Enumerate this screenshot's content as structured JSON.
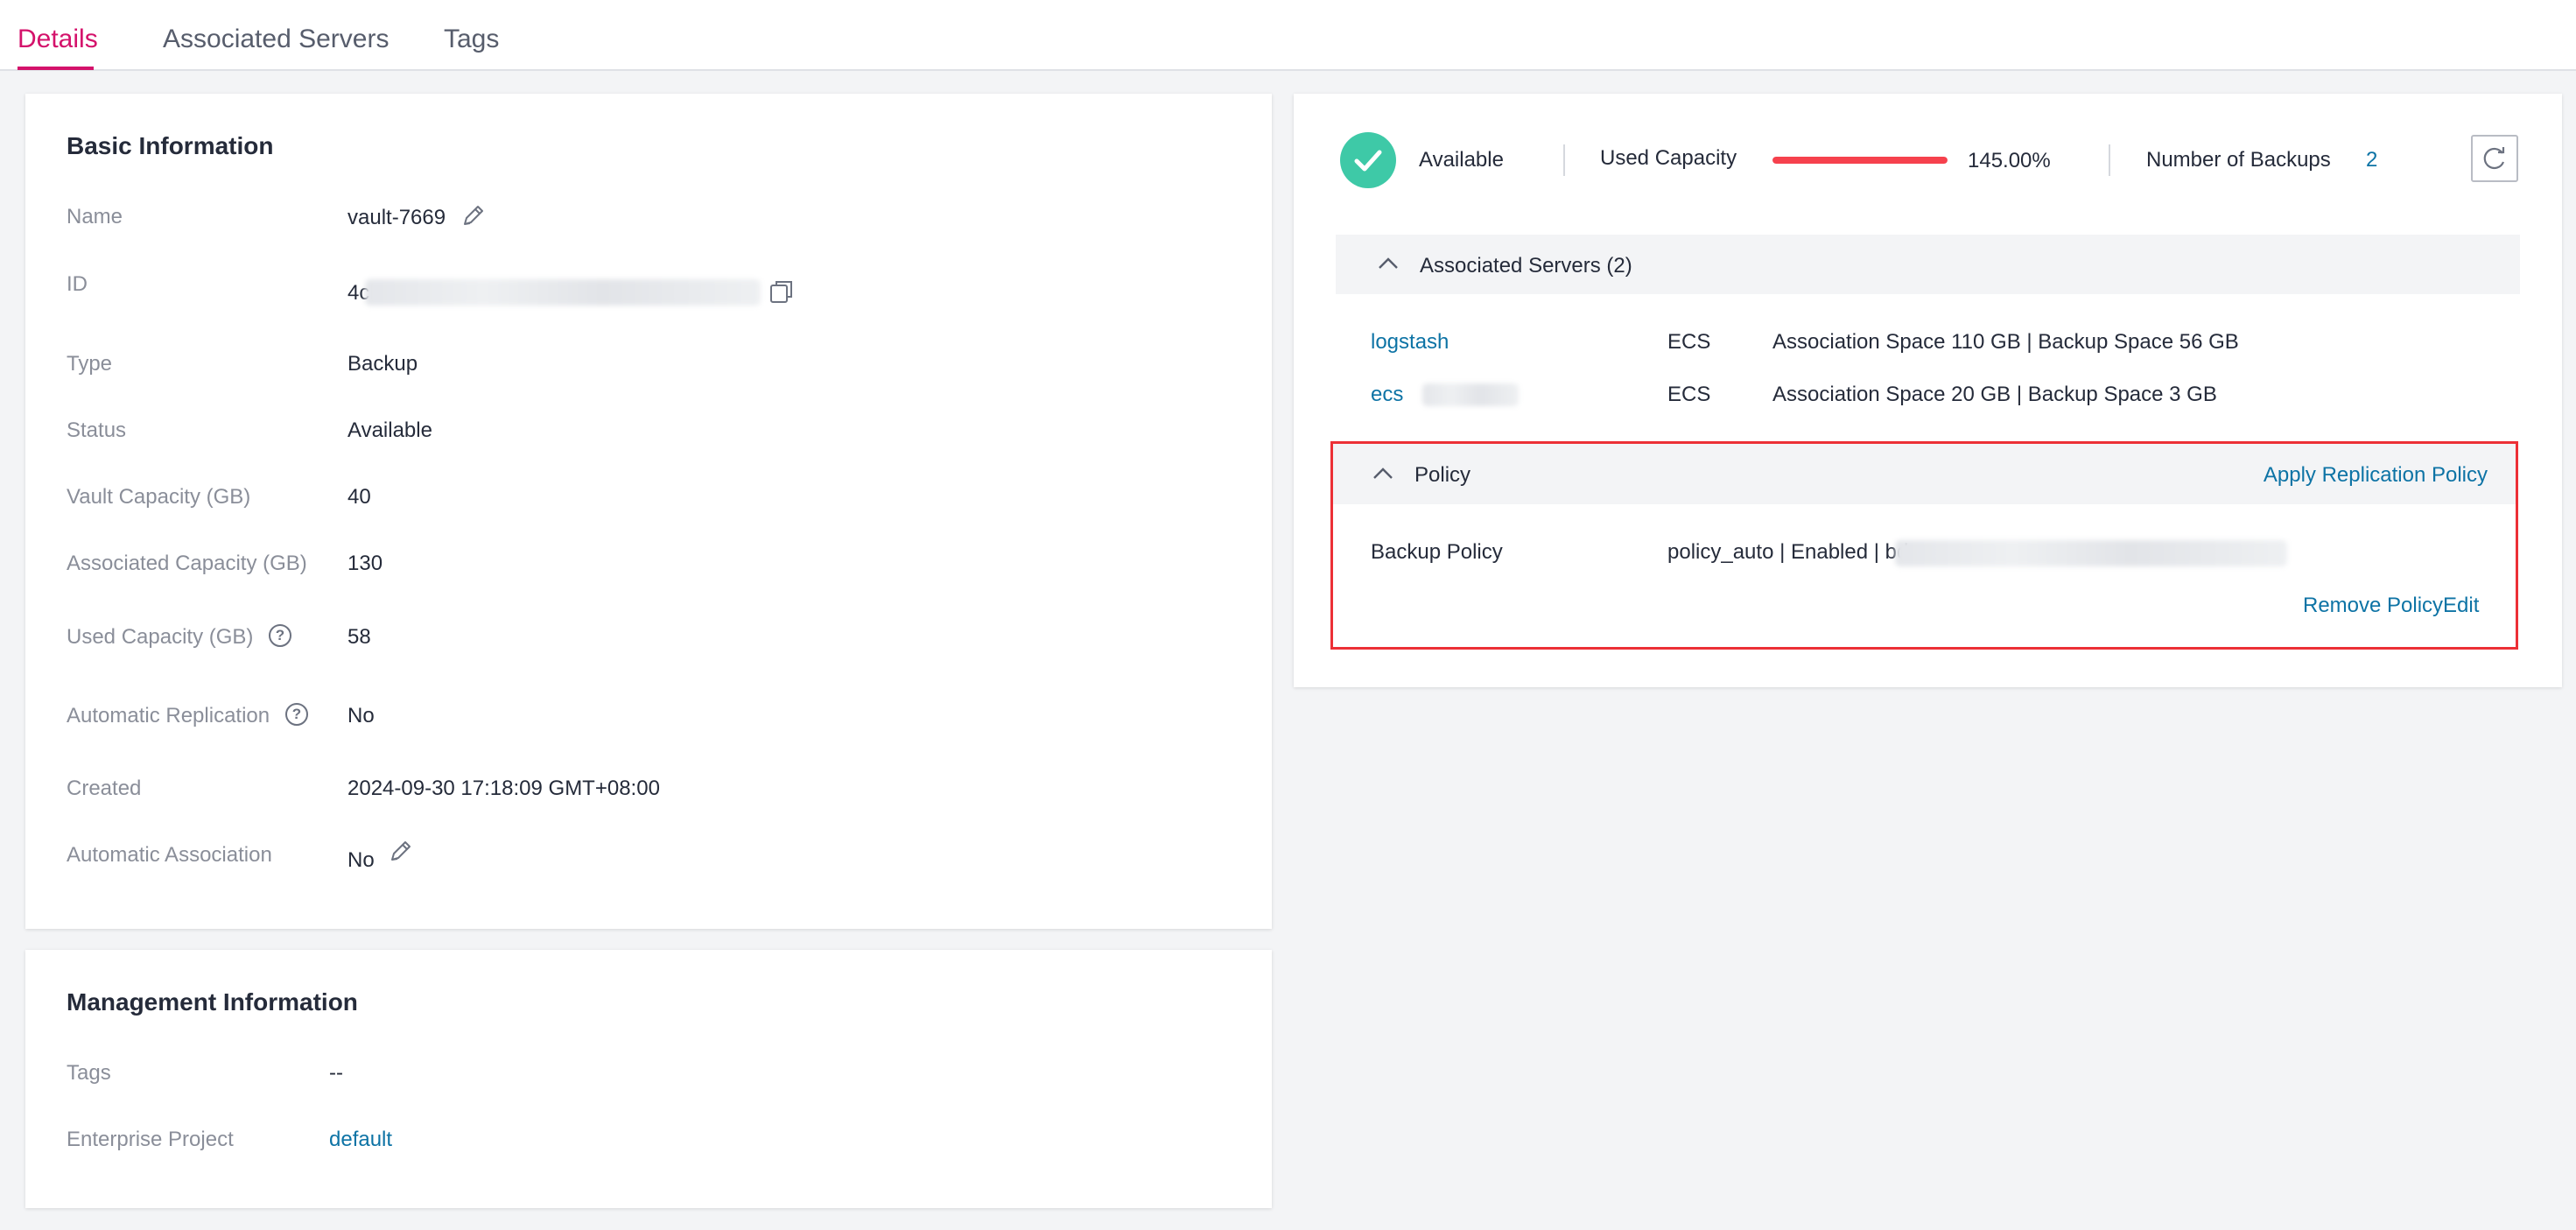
{
  "tabs": [
    {
      "label": "Details",
      "active": true
    },
    {
      "label": "Associated Servers",
      "active": false
    },
    {
      "label": "Tags",
      "active": false
    }
  ],
  "basic_info": {
    "title": "Basic Information",
    "rows": {
      "name": {
        "label": "Name",
        "value": "vault-7669"
      },
      "id": {
        "label": "ID",
        "value": "4c"
      },
      "type": {
        "label": "Type",
        "value": "Backup"
      },
      "status": {
        "label": "Status",
        "value": "Available"
      },
      "vault_capacity": {
        "label": "Vault Capacity (GB)",
        "value": "40"
      },
      "associated_capacity": {
        "label": "Associated Capacity (GB)",
        "value": "130"
      },
      "used_capacity": {
        "label": "Used Capacity (GB)",
        "value": "58"
      },
      "automatic_replication": {
        "label": "Automatic Replication",
        "value": "No"
      },
      "created": {
        "label": "Created",
        "value": "2024-09-30 17:18:09 GMT+08:00"
      },
      "automatic_association": {
        "label": "Automatic Association",
        "value": "No"
      }
    }
  },
  "management_info": {
    "title": "Management Information",
    "tags": {
      "label": "Tags",
      "value": "--"
    },
    "enterprise_project": {
      "label": "Enterprise Project",
      "value": "default"
    }
  },
  "summary": {
    "status_text": "Available",
    "used_capacity_label": "Used Capacity",
    "used_capacity_percent": "145.00%",
    "used_capacity_fill": 1.0,
    "backups_label": "Number of Backups",
    "backups_count": "2"
  },
  "associated_servers": {
    "header": "Associated Servers (2)",
    "items": [
      {
        "name": "logstash",
        "type": "ECS",
        "detail": "Association Space 110 GB | Backup Space 56 GB"
      },
      {
        "name": "ecs",
        "type": "ECS",
        "detail": "Association Space 20 GB | Backup Space 3 GB"
      }
    ]
  },
  "policy": {
    "header": "Policy",
    "apply_replication": "Apply Replication Policy",
    "backup_policy_label": "Backup Policy",
    "backup_policy_value": "policy_auto | Enabled | bd",
    "remove_policy": "Remove Policy",
    "edit": "Edit"
  },
  "colors": {
    "accent": "#d4126b",
    "link": "#0d73a5",
    "success": "#3ec9a7",
    "danger": "#f6414d",
    "highlight_border": "#ec3036"
  }
}
